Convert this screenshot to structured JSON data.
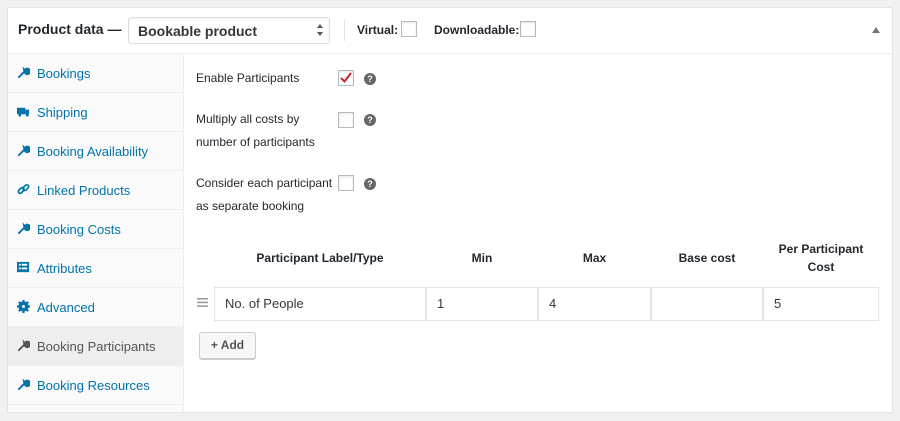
{
  "header": {
    "title": "Product data —",
    "product_type": "Bookable product",
    "virtual_label": "Virtual:",
    "downloadable_label": "Downloadable:"
  },
  "sidebar": {
    "items": [
      {
        "label": "Bookings",
        "icon": "wrench-icon"
      },
      {
        "label": "Shipping",
        "icon": "truck-icon"
      },
      {
        "label": "Booking Availability",
        "icon": "wrench-icon"
      },
      {
        "label": "Linked Products",
        "icon": "link-icon"
      },
      {
        "label": "Booking Costs",
        "icon": "wrench-icon"
      },
      {
        "label": "Attributes",
        "icon": "list-icon"
      },
      {
        "label": "Advanced",
        "icon": "gear-icon"
      },
      {
        "label": "Booking Participants",
        "icon": "wrench-icon",
        "active": true
      },
      {
        "label": "Booking Resources",
        "icon": "wrench-icon"
      }
    ]
  },
  "fields": {
    "enable_participants": {
      "label": "Enable Participants",
      "checked": true
    },
    "multiply_costs": {
      "label_line1": "Multiply all costs by",
      "label_line2": "number of participants",
      "checked": false
    },
    "separate_booking": {
      "label_line1": "Consider each participant",
      "label_line2": "as separate booking",
      "checked": false
    }
  },
  "table": {
    "headers": {
      "label": "Participant Label/Type",
      "min": "Min",
      "max": "Max",
      "base_cost": "Base cost",
      "per_cost_line1": "Per Participant",
      "per_cost_line2": "Cost"
    },
    "rows": [
      {
        "label": "No. of People",
        "min": "1",
        "max": "4",
        "base_cost": "",
        "per_cost": "5"
      }
    ]
  },
  "add_button": "+ Add",
  "colors": {
    "link": "#0073aa",
    "check": "#c9242c",
    "border": "#e5e5e5"
  }
}
